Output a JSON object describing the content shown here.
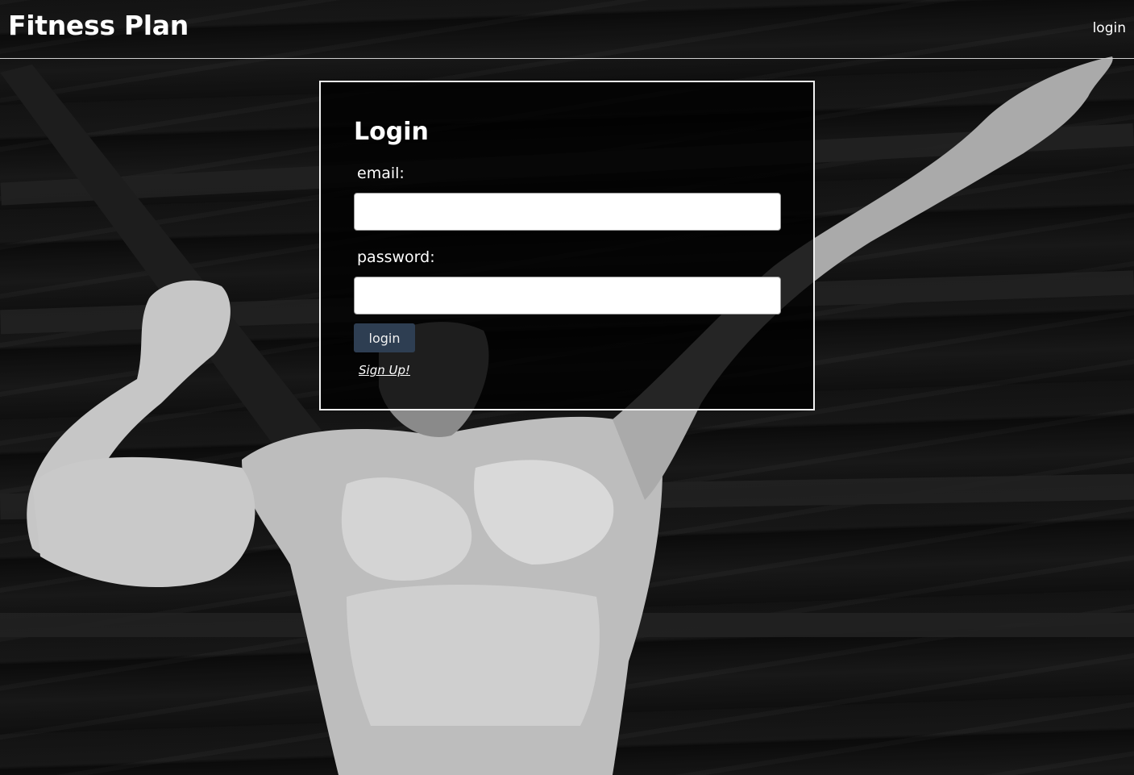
{
  "header": {
    "brand": "Fitness Plan",
    "nav_login": "login"
  },
  "login_form": {
    "title": "Login",
    "email_label": "email:",
    "email_value": "",
    "password_label": "password:",
    "password_value": "",
    "submit_label": "login",
    "signup_link": "Sign Up!"
  },
  "colors": {
    "background": "#000000",
    "text": "#ffffff",
    "button": "#2e3e52",
    "border": "#f2f2f2"
  }
}
